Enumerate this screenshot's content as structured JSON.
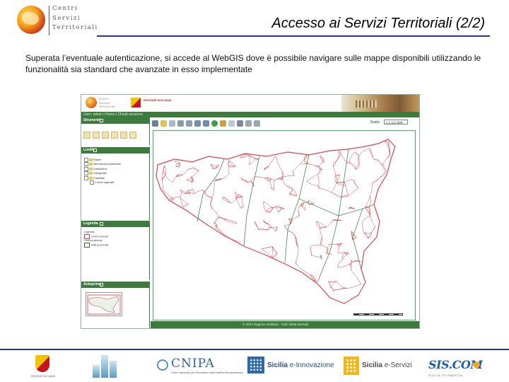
{
  "header": {
    "logo_lines": [
      "Centri",
      "Servizi",
      "Territoriali"
    ],
    "title": "Accesso ai Servizi Territoriali (2/2)"
  },
  "intro": "Superata l’eventuale autenticazione, si accede al WebGIS dove è possibile navigare sulle mappe disponibili utilizzando le funzionalità sia standard che avanzate in esso implementate",
  "webgis": {
    "banner_logo_lines": [
      "Centri",
      "Servizi",
      "Territoriali"
    ],
    "region_label": "REGIONE SICILIANA",
    "subbar_text": "User: admin  |  Home  |  Chiudi sessione",
    "panels": {
      "tools_title": "Strumenti",
      "layers_title": "Livelli",
      "legend_title": "Legenda",
      "overview_title": "Anteprima"
    },
    "layers": [
      {
        "label": "Raster"
      },
      {
        "label": "Informazioni ambientali"
      },
      {
        "label": "Urbanistica"
      },
      {
        "label": "Cartografia"
      },
      {
        "label": "Catastale"
      },
      {
        "label": "Confini regionali"
      }
    ],
    "legend": {
      "heading1": "Legenda",
      "item1": "Limiti comunali",
      "heading2": "Limiti provinciali",
      "item2": "limiti provinciali"
    },
    "scale_label": "Scala:",
    "scale_value": "1:1.112.500",
    "footer_text": "© 2007 Regione Siciliana - Tutti i diritti riservati",
    "map_line_color": "#d9434f",
    "theme_green": "#3d7a3d"
  },
  "partners": [
    {
      "name": "Regione Siciliana",
      "caption": "REGIONE SICILIANA"
    },
    {
      "name": "Building"
    },
    {
      "name": "CNIPA",
      "text": "CNIPA",
      "caption": "Centro Nazionale per l'Informatica nella Pubblica Amministrazione"
    },
    {
      "name": "Sicilia e-Innovazione",
      "text_a": "Sicilia",
      "text_b": "e-Innovazione"
    },
    {
      "name": "Sicilia e-Servizi",
      "text_a": "Sicilia",
      "text_b": "e-Servizi"
    },
    {
      "name": "SIS.COM",
      "text": "SIS.COM",
      "caption": "SICILIA TELEMATICA"
    }
  ]
}
